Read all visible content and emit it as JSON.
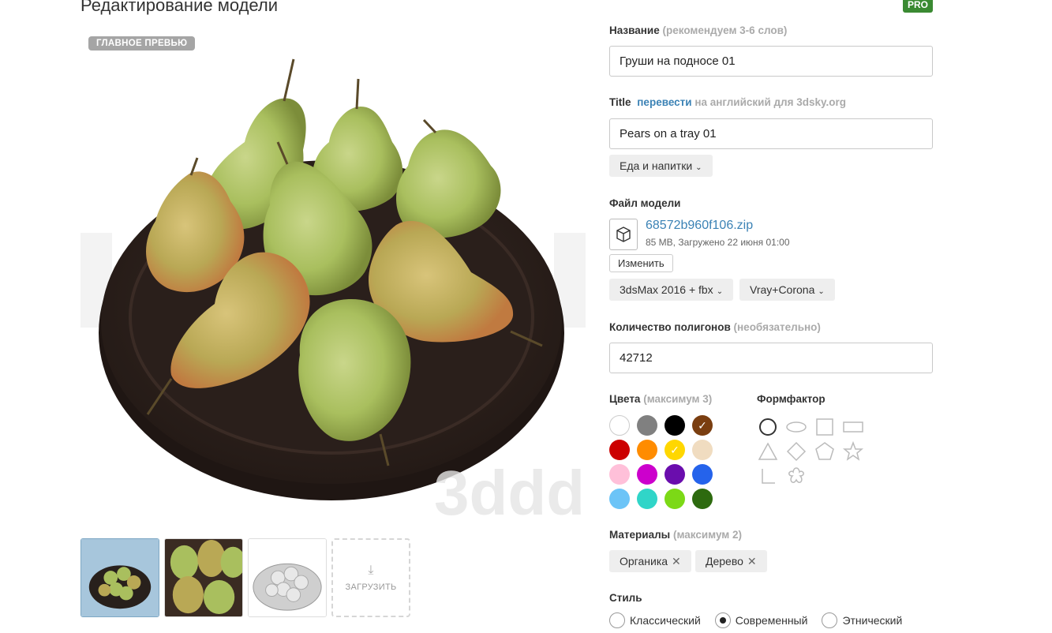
{
  "page": {
    "title": "Редактирование модели",
    "pro_badge": "PRO"
  },
  "preview": {
    "main_badge": "ГЛАВНОЕ ПРЕВЬЮ",
    "upload_label": "ЗАГРУЗИТЬ",
    "watermark": "3ddd"
  },
  "form": {
    "name_label": "Название",
    "name_hint": "(рекомендуем 3-6 слов)",
    "name_value": "Груши на подносе 01",
    "title_label": "Title",
    "title_link": "перевести",
    "title_hint": "на английский для 3dsky.org",
    "title_value": "Pears on a tray 01",
    "category": "Еда и напитки",
    "file_label": "Файл модели",
    "file_name": "68572b960f106.zip",
    "file_meta": "85 MB, Загружено 22 июня 01:00",
    "change_button": "Изменить",
    "format": "3dsMax 2016 + fbx",
    "renderer": "Vray+Corona",
    "polygons_label": "Количество полигонов",
    "polygons_hint": "(необязательно)",
    "polygons_value": "42712",
    "colors_label": "Цвета",
    "colors_hint": "(максимум 3)",
    "formfactor_label": "Формфактор",
    "materials_label": "Материалы",
    "materials_hint": "(максимум 2)",
    "materials": [
      {
        "label": "Органика"
      },
      {
        "label": "Дерево"
      }
    ],
    "style_label": "Стиль",
    "styles": [
      {
        "label": "Классический",
        "selected": false
      },
      {
        "label": "Современный",
        "selected": true
      },
      {
        "label": "Этнический",
        "selected": false
      }
    ]
  },
  "colors": [
    {
      "name": "white",
      "hex": "#ffffff",
      "selected": false
    },
    {
      "name": "gray",
      "hex": "#808080",
      "selected": false
    },
    {
      "name": "black",
      "hex": "#000000",
      "selected": false
    },
    {
      "name": "brown",
      "hex": "#7a3e10",
      "selected": true
    },
    {
      "name": "red",
      "hex": "#cc0000",
      "selected": false
    },
    {
      "name": "orange",
      "hex": "#ff8c00",
      "selected": false
    },
    {
      "name": "yellow",
      "hex": "#ffd700",
      "selected": true
    },
    {
      "name": "beige",
      "hex": "#f0dcc0",
      "selected": false
    },
    {
      "name": "pink",
      "hex": "#ffc0d9",
      "selected": false
    },
    {
      "name": "magenta",
      "hex": "#cc00cc",
      "selected": false
    },
    {
      "name": "purple",
      "hex": "#6a0dad",
      "selected": false
    },
    {
      "name": "blue",
      "hex": "#2563eb",
      "selected": false
    },
    {
      "name": "light-blue",
      "hex": "#6cc4f7",
      "selected": false
    },
    {
      "name": "turquoise",
      "hex": "#30d5c8",
      "selected": false
    },
    {
      "name": "lime",
      "hex": "#7cd916",
      "selected": false
    },
    {
      "name": "dark-green",
      "hex": "#2d6a0f",
      "selected": false
    }
  ],
  "shapes": [
    {
      "name": "circle-icon",
      "selected": true
    },
    {
      "name": "ellipse-icon",
      "selected": false
    },
    {
      "name": "square-icon",
      "selected": false
    },
    {
      "name": "rectangle-icon",
      "selected": false
    },
    {
      "name": "triangle-icon",
      "selected": false
    },
    {
      "name": "diamond-icon",
      "selected": false
    },
    {
      "name": "pentagon-icon",
      "selected": false
    },
    {
      "name": "star-icon",
      "selected": false
    },
    {
      "name": "l-shape-icon",
      "selected": false
    },
    {
      "name": "flower-icon",
      "selected": false
    }
  ]
}
